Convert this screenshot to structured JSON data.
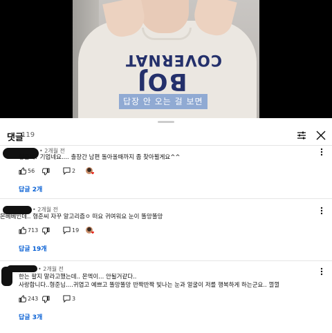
{
  "video": {
    "subtitle": "답장 안 오는 걸 보면",
    "shirt_print_top": "COVERNAT",
    "shirt_print_bottom": "BOJ"
  },
  "comments_panel": {
    "title": "댓글",
    "count": "119",
    "filter_icon": "filter-icon",
    "close_icon": "close-icon"
  },
  "comments": [
    {
      "time": "• 2개월 전",
      "lines": [
        "형준씨? 기업네요.... 출장간 남편 돌아올때까지 좀 찾아뵐게요^^"
      ],
      "likes": "56",
      "replies_count": "2",
      "replies_label": "답글 2개"
    },
    {
      "time": "• 2개월 전",
      "lines": [
        "몬베베인데.. 형준씨 자꾸 알고리즘ㅇ 떠요 귀여워요 눈이 똘망똘망"
      ],
      "likes": "713",
      "replies_count": "19",
      "replies_label": "답글 19개"
    },
    {
      "time": "• 2개월 전",
      "lines": [
        "한는 팔지 말라고했는데.. 몬엑이... 안될거같다..",
        "사랑합니다..형준님....귀엽고 예쁘고 똘망똘망 반짝반짝 빛나는 눈과 얼굴이 저를 행복하게 하는군요.. 껄껄"
      ],
      "likes": "243",
      "replies_count": "3",
      "replies_label": "답글 3개"
    }
  ]
}
